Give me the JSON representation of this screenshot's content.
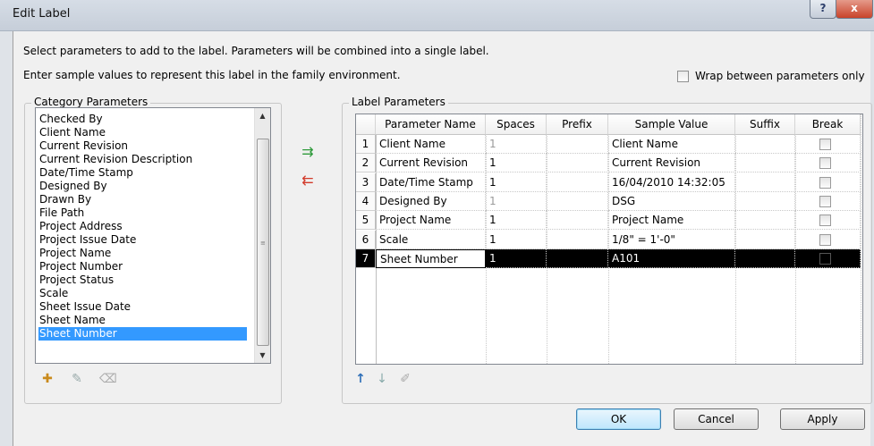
{
  "window": {
    "title": "Edit Label",
    "help_label": "?",
    "close_label": "x"
  },
  "instructions": {
    "line1": "Select parameters to add to the label.  Parameters will be combined into a single label.",
    "line2": "Enter sample values to represent this label in the family environment."
  },
  "wrap_option": {
    "label": "Wrap between parameters only",
    "checked": false
  },
  "category_parameters": {
    "title": "Category Parameters",
    "items": [
      "Checked By",
      "Client Name",
      "Current Revision",
      "Current Revision Description",
      "Date/Time Stamp",
      "Designed By",
      "Drawn By",
      "File Path",
      "Project Address",
      "Project Issue Date",
      "Project Name",
      "Project Number",
      "Project Status",
      "Scale",
      "Sheet Issue Date",
      "Sheet Name",
      "Sheet Number"
    ],
    "selected": "Sheet Number",
    "toolbar_icons": [
      "add-parameter-icon",
      "edit-parameter-icon",
      "remove-parameter-icon"
    ]
  },
  "transfer_icons": [
    "add-to-label-icon",
    "remove-from-label-icon"
  ],
  "label_parameters": {
    "title": "Label Parameters",
    "columns": [
      "Parameter Name",
      "Spaces",
      "Prefix",
      "Sample Value",
      "Suffix",
      "Break"
    ],
    "rows": [
      {
        "num": "1",
        "name": "Client Name",
        "spaces": "1",
        "prefix": "",
        "sample": "Client Name",
        "suffix": "",
        "break": false,
        "spaces_dim": true
      },
      {
        "num": "2",
        "name": "Current Revision",
        "spaces": "1",
        "prefix": "",
        "sample": "Current Revision",
        "suffix": "",
        "break": false,
        "spaces_dim": false
      },
      {
        "num": "3",
        "name": "Date/Time Stamp",
        "spaces": "1",
        "prefix": "",
        "sample": "16/04/2010 14:32:05",
        "suffix": "",
        "break": false,
        "spaces_dim": false
      },
      {
        "num": "4",
        "name": "Designed By",
        "spaces": "1",
        "prefix": "",
        "sample": "DSG",
        "suffix": "",
        "break": false,
        "spaces_dim": true
      },
      {
        "num": "5",
        "name": "Project Name",
        "spaces": "1",
        "prefix": "",
        "sample": "Project Name",
        "suffix": "",
        "break": false,
        "spaces_dim": false
      },
      {
        "num": "6",
        "name": "Scale",
        "spaces": "1",
        "prefix": "",
        "sample": "1/8\" = 1'-0\"",
        "suffix": "",
        "break": false,
        "spaces_dim": false
      },
      {
        "num": "7",
        "name": "Sheet Number",
        "spaces": "1",
        "prefix": "",
        "sample": "A101",
        "suffix": "",
        "break": false,
        "spaces_dim": false
      }
    ],
    "selected_row": "7",
    "toolbar_icons": [
      "move-up-icon",
      "move-down-icon",
      "edit-format-icon"
    ]
  },
  "buttons": {
    "ok": "OK",
    "cancel": "Cancel",
    "apply": "Apply"
  },
  "colors": {
    "selection": "#3399ff",
    "grid_selection": "#000000",
    "add_arrow": "#2e9a3a",
    "remove_arrow": "#d23a2a",
    "icon_blue": "#2f6fb8"
  }
}
